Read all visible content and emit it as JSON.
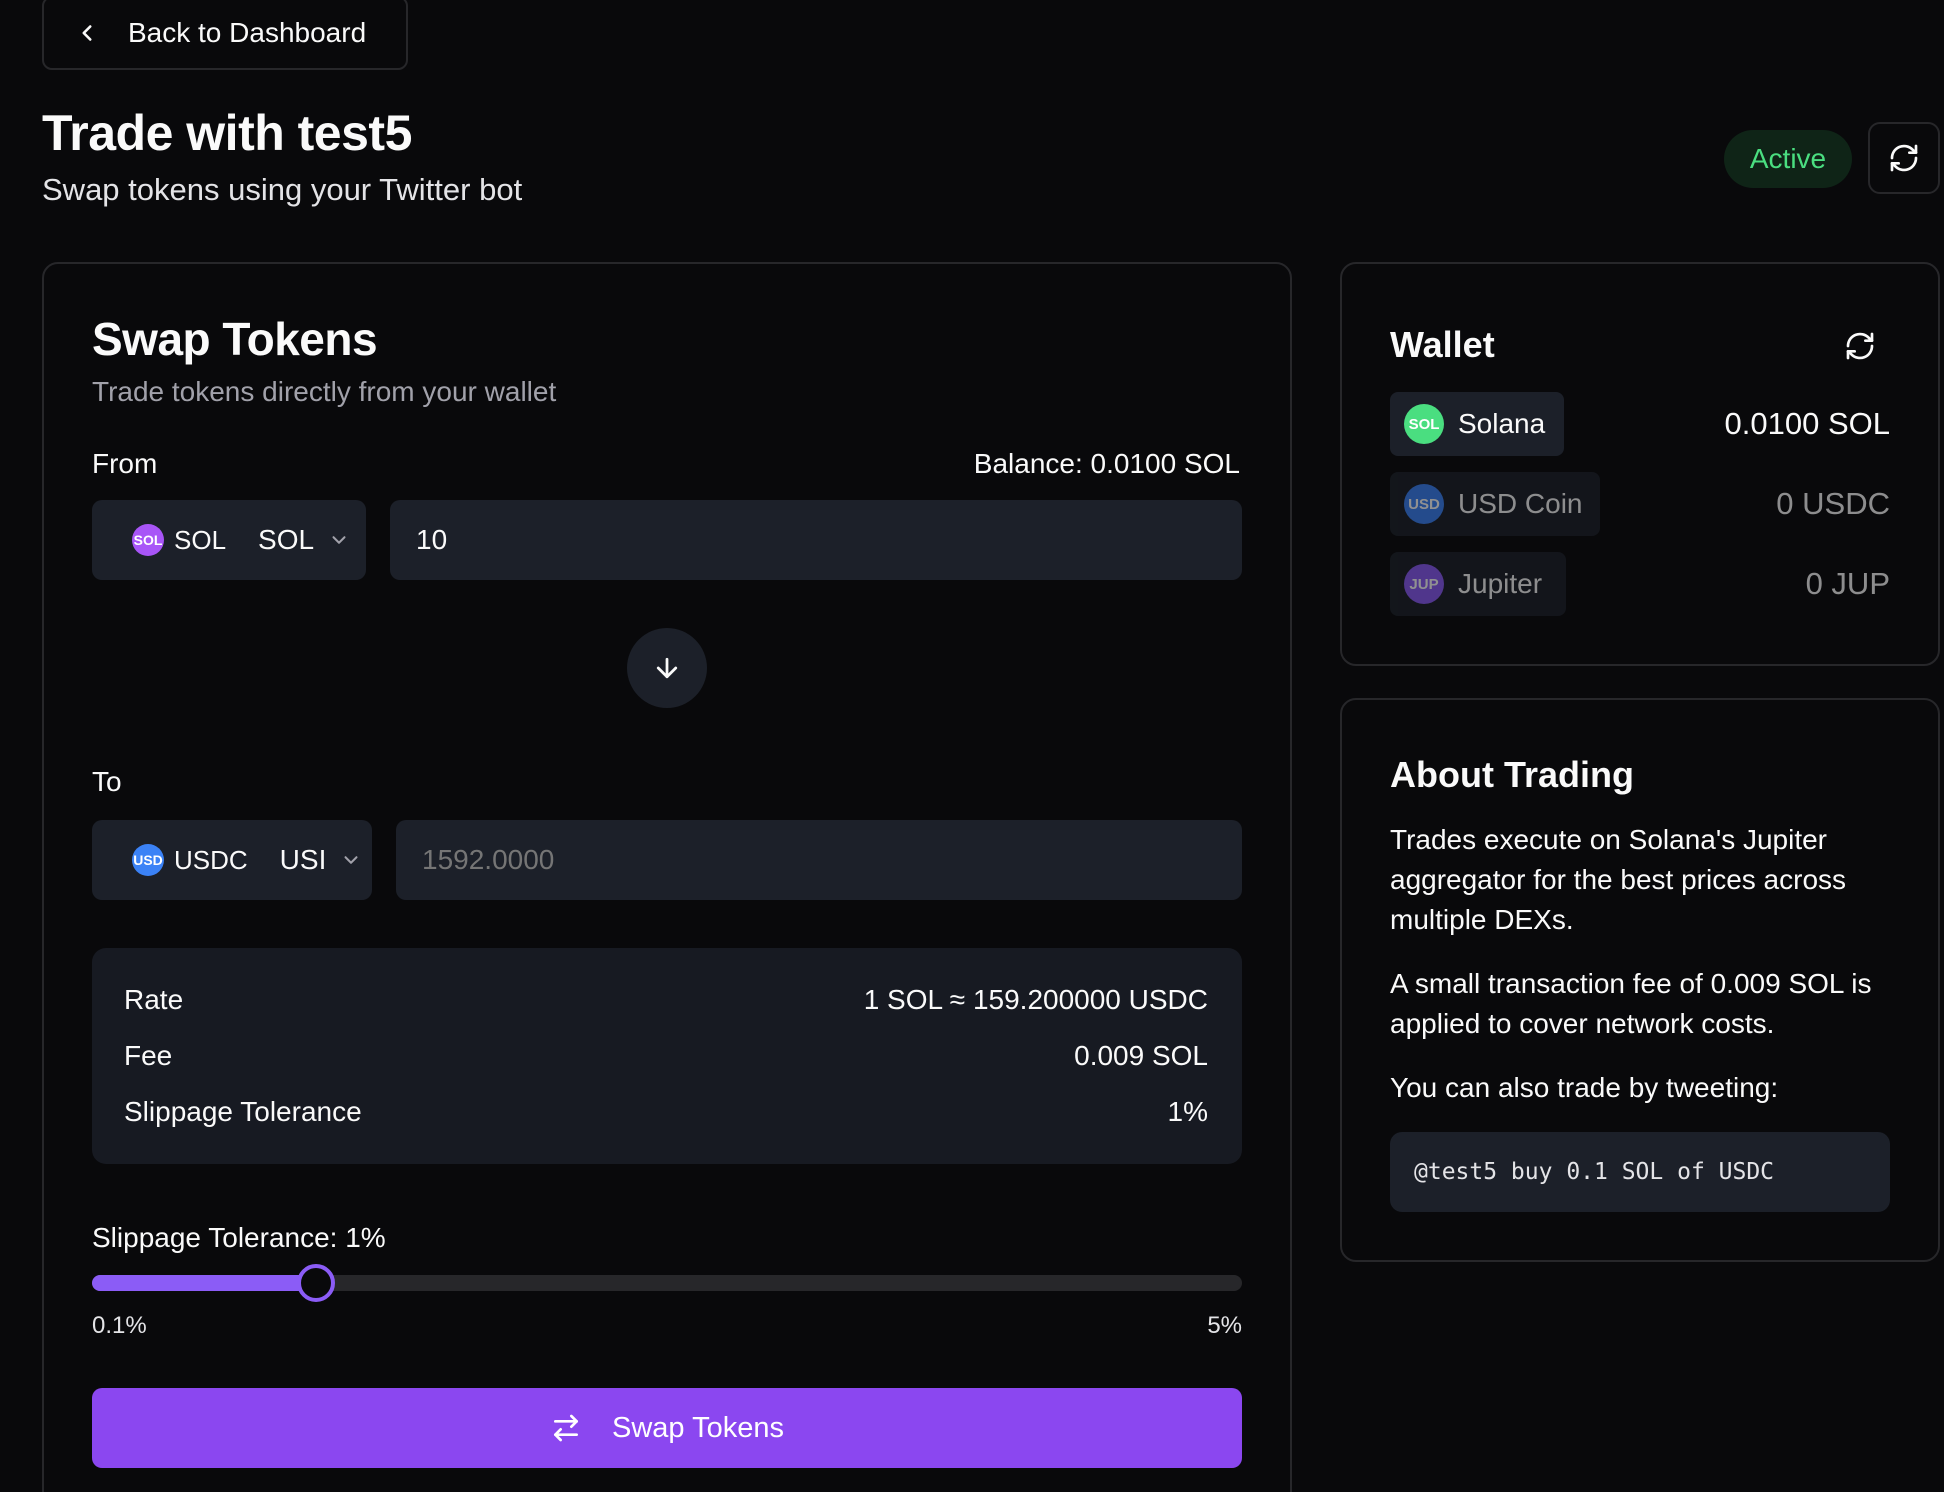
{
  "nav": {
    "back_label": "Back to Dashboard"
  },
  "header": {
    "title": "Trade with test5",
    "subtitle": "Swap tokens using your Twitter bot",
    "status": "Active"
  },
  "swap": {
    "title": "Swap Tokens",
    "description": "Trade tokens directly from your wallet",
    "from": {
      "label": "From",
      "balance": "Balance: 0.0100 SOL",
      "token_badge": "SOL",
      "token_name": "SOL",
      "selected": "SOL",
      "amount": "10"
    },
    "to": {
      "label": "To",
      "token_badge": "USD",
      "token_name": "USDC",
      "selected": "USI",
      "amount_placeholder": "1592.0000"
    },
    "details": [
      {
        "label": "Rate",
        "value": "1 SOL ≈ 159.200000 USDC"
      },
      {
        "label": "Fee",
        "value": "0.009 SOL"
      },
      {
        "label": "Slippage Tolerance",
        "value": "1%"
      }
    ],
    "slippage": {
      "label": "Slippage Tolerance: 1%",
      "value": 1,
      "min_label": "0.1%",
      "max_label": "5%"
    },
    "button_label": "Swap Tokens"
  },
  "wallet": {
    "title": "Wallet",
    "tokens": [
      {
        "badge": "SOL",
        "name": "Solana",
        "amount": "0.0100 SOL",
        "color": "#4ade80"
      },
      {
        "badge": "USD",
        "name": "USD Coin",
        "amount": "0 USDC",
        "color": "#3b82f6"
      },
      {
        "badge": "JUP",
        "name": "Jupiter",
        "amount": "0 JUP",
        "color": "#8b5cf6"
      }
    ]
  },
  "about": {
    "title": "About Trading",
    "paragraphs": [
      "Trades execute on Solana's Jupiter aggregator for the best prices across multiple DEXs.",
      "A small transaction fee of 0.009 SOL is applied to cover network costs.",
      "You can also trade by tweeting:"
    ],
    "example_tweet": "@test5 buy 0.1 SOL of USDC"
  },
  "colors": {
    "accent": "#8b47f0",
    "active_green": "#4ade80",
    "background": "#09090b",
    "surface": "#1c2029"
  },
  "icons": [
    "chevron-left-icon",
    "refresh-icon",
    "chevron-down-icon",
    "arrow-down-icon",
    "swap-arrows-icon"
  ]
}
